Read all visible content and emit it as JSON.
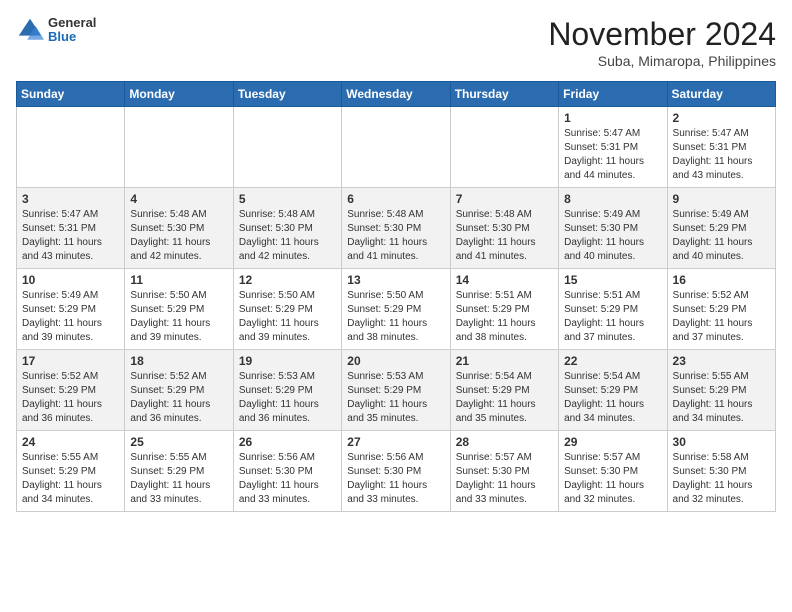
{
  "header": {
    "logo_general": "General",
    "logo_blue": "Blue",
    "month_year": "November 2024",
    "location": "Suba, Mimaropa, Philippines"
  },
  "days_of_week": [
    "Sunday",
    "Monday",
    "Tuesday",
    "Wednesday",
    "Thursday",
    "Friday",
    "Saturday"
  ],
  "weeks": [
    [
      {
        "day": "",
        "info": ""
      },
      {
        "day": "",
        "info": ""
      },
      {
        "day": "",
        "info": ""
      },
      {
        "day": "",
        "info": ""
      },
      {
        "day": "",
        "info": ""
      },
      {
        "day": "1",
        "info": "Sunrise: 5:47 AM\nSunset: 5:31 PM\nDaylight: 11 hours and 44 minutes."
      },
      {
        "day": "2",
        "info": "Sunrise: 5:47 AM\nSunset: 5:31 PM\nDaylight: 11 hours and 43 minutes."
      }
    ],
    [
      {
        "day": "3",
        "info": "Sunrise: 5:47 AM\nSunset: 5:31 PM\nDaylight: 11 hours and 43 minutes."
      },
      {
        "day": "4",
        "info": "Sunrise: 5:48 AM\nSunset: 5:30 PM\nDaylight: 11 hours and 42 minutes."
      },
      {
        "day": "5",
        "info": "Sunrise: 5:48 AM\nSunset: 5:30 PM\nDaylight: 11 hours and 42 minutes."
      },
      {
        "day": "6",
        "info": "Sunrise: 5:48 AM\nSunset: 5:30 PM\nDaylight: 11 hours and 41 minutes."
      },
      {
        "day": "7",
        "info": "Sunrise: 5:48 AM\nSunset: 5:30 PM\nDaylight: 11 hours and 41 minutes."
      },
      {
        "day": "8",
        "info": "Sunrise: 5:49 AM\nSunset: 5:30 PM\nDaylight: 11 hours and 40 minutes."
      },
      {
        "day": "9",
        "info": "Sunrise: 5:49 AM\nSunset: 5:29 PM\nDaylight: 11 hours and 40 minutes."
      }
    ],
    [
      {
        "day": "10",
        "info": "Sunrise: 5:49 AM\nSunset: 5:29 PM\nDaylight: 11 hours and 39 minutes."
      },
      {
        "day": "11",
        "info": "Sunrise: 5:50 AM\nSunset: 5:29 PM\nDaylight: 11 hours and 39 minutes."
      },
      {
        "day": "12",
        "info": "Sunrise: 5:50 AM\nSunset: 5:29 PM\nDaylight: 11 hours and 39 minutes."
      },
      {
        "day": "13",
        "info": "Sunrise: 5:50 AM\nSunset: 5:29 PM\nDaylight: 11 hours and 38 minutes."
      },
      {
        "day": "14",
        "info": "Sunrise: 5:51 AM\nSunset: 5:29 PM\nDaylight: 11 hours and 38 minutes."
      },
      {
        "day": "15",
        "info": "Sunrise: 5:51 AM\nSunset: 5:29 PM\nDaylight: 11 hours and 37 minutes."
      },
      {
        "day": "16",
        "info": "Sunrise: 5:52 AM\nSunset: 5:29 PM\nDaylight: 11 hours and 37 minutes."
      }
    ],
    [
      {
        "day": "17",
        "info": "Sunrise: 5:52 AM\nSunset: 5:29 PM\nDaylight: 11 hours and 36 minutes."
      },
      {
        "day": "18",
        "info": "Sunrise: 5:52 AM\nSunset: 5:29 PM\nDaylight: 11 hours and 36 minutes."
      },
      {
        "day": "19",
        "info": "Sunrise: 5:53 AM\nSunset: 5:29 PM\nDaylight: 11 hours and 36 minutes."
      },
      {
        "day": "20",
        "info": "Sunrise: 5:53 AM\nSunset: 5:29 PM\nDaylight: 11 hours and 35 minutes."
      },
      {
        "day": "21",
        "info": "Sunrise: 5:54 AM\nSunset: 5:29 PM\nDaylight: 11 hours and 35 minutes."
      },
      {
        "day": "22",
        "info": "Sunrise: 5:54 AM\nSunset: 5:29 PM\nDaylight: 11 hours and 34 minutes."
      },
      {
        "day": "23",
        "info": "Sunrise: 5:55 AM\nSunset: 5:29 PM\nDaylight: 11 hours and 34 minutes."
      }
    ],
    [
      {
        "day": "24",
        "info": "Sunrise: 5:55 AM\nSunset: 5:29 PM\nDaylight: 11 hours and 34 minutes."
      },
      {
        "day": "25",
        "info": "Sunrise: 5:55 AM\nSunset: 5:29 PM\nDaylight: 11 hours and 33 minutes."
      },
      {
        "day": "26",
        "info": "Sunrise: 5:56 AM\nSunset: 5:30 PM\nDaylight: 11 hours and 33 minutes."
      },
      {
        "day": "27",
        "info": "Sunrise: 5:56 AM\nSunset: 5:30 PM\nDaylight: 11 hours and 33 minutes."
      },
      {
        "day": "28",
        "info": "Sunrise: 5:57 AM\nSunset: 5:30 PM\nDaylight: 11 hours and 33 minutes."
      },
      {
        "day": "29",
        "info": "Sunrise: 5:57 AM\nSunset: 5:30 PM\nDaylight: 11 hours and 32 minutes."
      },
      {
        "day": "30",
        "info": "Sunrise: 5:58 AM\nSunset: 5:30 PM\nDaylight: 11 hours and 32 minutes."
      }
    ]
  ]
}
